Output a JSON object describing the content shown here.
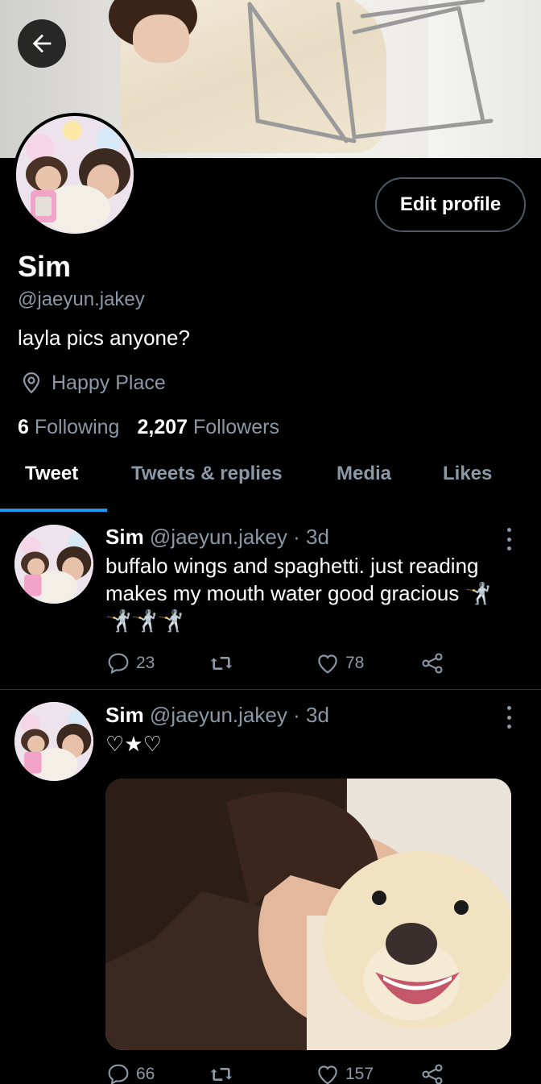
{
  "profile": {
    "edit_label": "Edit profile",
    "name": "Sim",
    "handle": "@jaeyun.jakey",
    "bio": "layla pics anyone?",
    "location": "Happy Place",
    "following_count": "6",
    "following_label": "Following",
    "followers_count": "2,207",
    "followers_label": "Followers"
  },
  "tabs": [
    {
      "label": "Tweet"
    },
    {
      "label": "Tweets & replies"
    },
    {
      "label": "Media"
    },
    {
      "label": "Likes"
    }
  ],
  "tweets": [
    {
      "name": "Sim",
      "handle": "@jaeyun.jakey",
      "dot": "·",
      "time": "3d",
      "text": "buffalo wings and spaghetti. just reading makes my mouth water good gracious",
      "emoji": "🤺🤺🤺🤺",
      "replies": "23",
      "likes": "78"
    },
    {
      "name": "Sim",
      "handle": "@jaeyun.jakey",
      "dot": "·",
      "time": "3d",
      "text": "♡★♡",
      "replies": "66",
      "likes": "157"
    }
  ],
  "colors": {
    "background": "#000000",
    "muted_text": "#8b98a5",
    "accent": "#1d9bf0",
    "border": "#2f3336"
  },
  "icons": {
    "back": "arrow-left-icon",
    "location": "map-pin-icon",
    "reply": "speech-bubble-icon",
    "retweet": "retweet-icon",
    "like": "heart-icon",
    "share": "share-icon",
    "more": "more-vertical-icon"
  }
}
